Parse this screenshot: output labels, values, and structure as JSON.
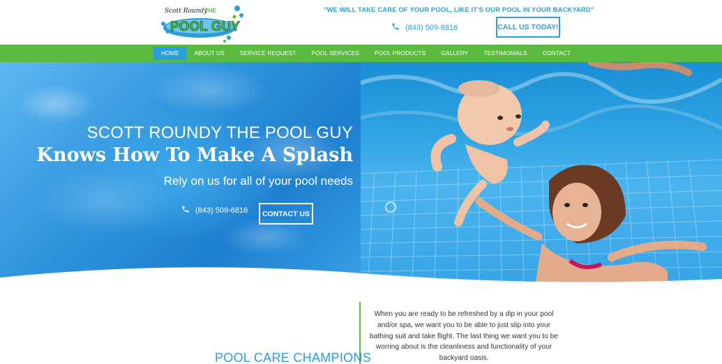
{
  "header": {
    "logo_text": "Scott Roundy THE POOL GUY",
    "tagline": "\"WE WILL TAKE CARE OF YOUR POOL, LIKE IT'S OUR POOL IN YOUR BACKYARD\"",
    "phone": "(843) 509-6816",
    "cta_label": "CALL US TODAY!"
  },
  "nav": {
    "items": [
      {
        "label": "HOME",
        "active": true
      },
      {
        "label": "ABOUT US"
      },
      {
        "label": "SERVICE REQUEST"
      },
      {
        "label": "POOL SERVICES"
      },
      {
        "label": "POOL PRODUCTS"
      },
      {
        "label": "GALLERY"
      },
      {
        "label": "TESTIMONIALS"
      },
      {
        "label": "CONTACT"
      }
    ]
  },
  "hero": {
    "line1": "SCOTT ROUNDY THE POOL GUY",
    "line2": "Knows How To Make A Splash",
    "line3": "Rely on us for all of your pool needs",
    "phone": "(843) 509-6816",
    "cta_label": "CONTACT US"
  },
  "content": {
    "heading": "POOL CARE CHAMPIONS",
    "intro": "When you are ready to be refreshed by a dip in your pool and/or spa, we want you to be able to just slip into your bathing suit and take flight. The last thing we want you to be worring about is the cleanliness and functionality of your backyard oasis."
  },
  "colors": {
    "brand_blue": "#2a9fd8",
    "nav_green": "#5ab93f",
    "text": "#333333"
  }
}
